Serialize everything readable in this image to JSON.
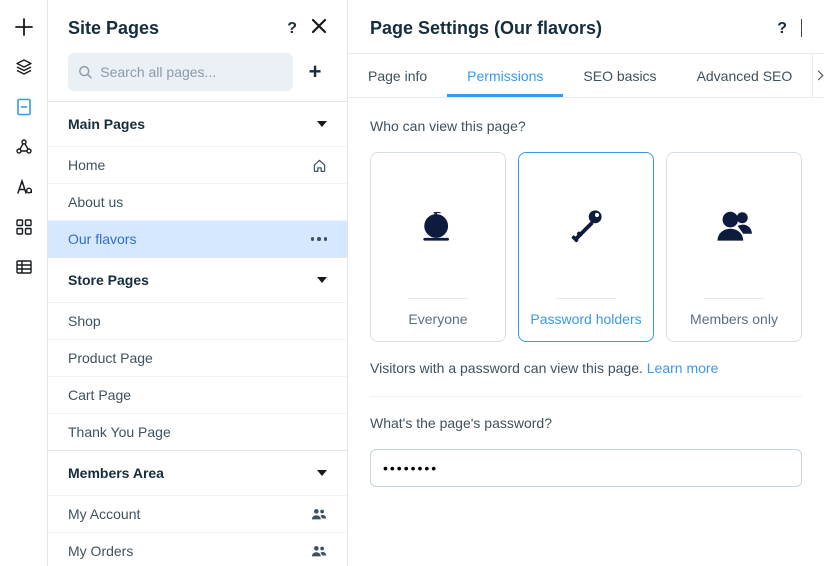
{
  "rail": {
    "items": [
      "add",
      "layers",
      "page",
      "connections",
      "text-style",
      "apps",
      "table"
    ],
    "active_index": 2
  },
  "pages_panel": {
    "title": "Site Pages",
    "search_placeholder": "Search all pages...",
    "sections": [
      {
        "label": "Main Pages",
        "items": [
          {
            "label": "Home",
            "trail": "home-icon"
          },
          {
            "label": "About us"
          },
          {
            "label": "Our flavors",
            "selected": true,
            "trail": "more"
          }
        ]
      },
      {
        "label": "Store Pages",
        "items": [
          {
            "label": "Shop"
          },
          {
            "label": "Product Page"
          },
          {
            "label": "Cart Page"
          },
          {
            "label": "Thank You Page"
          }
        ]
      },
      {
        "label": "Members Area",
        "items": [
          {
            "label": "My Account",
            "trail": "members-icon"
          },
          {
            "label": "My Orders",
            "trail": "members-icon"
          }
        ]
      }
    ]
  },
  "settings": {
    "title": "Page Settings (Our flavors)",
    "tabs": [
      "Page info",
      "Permissions",
      "SEO basics",
      "Advanced SEO"
    ],
    "active_tab_index": 1,
    "permissions": {
      "question": "Who can view this page?",
      "options": [
        {
          "label": "Everyone",
          "icon": "globe"
        },
        {
          "label": "Password holders",
          "icon": "key"
        },
        {
          "label": "Members only",
          "icon": "members"
        }
      ],
      "selected_index": 1,
      "description": "Visitors with a password can view this page. ",
      "learn_more": "Learn more",
      "password_label": "What's the page's password?",
      "password_value": "••••••••"
    }
  }
}
